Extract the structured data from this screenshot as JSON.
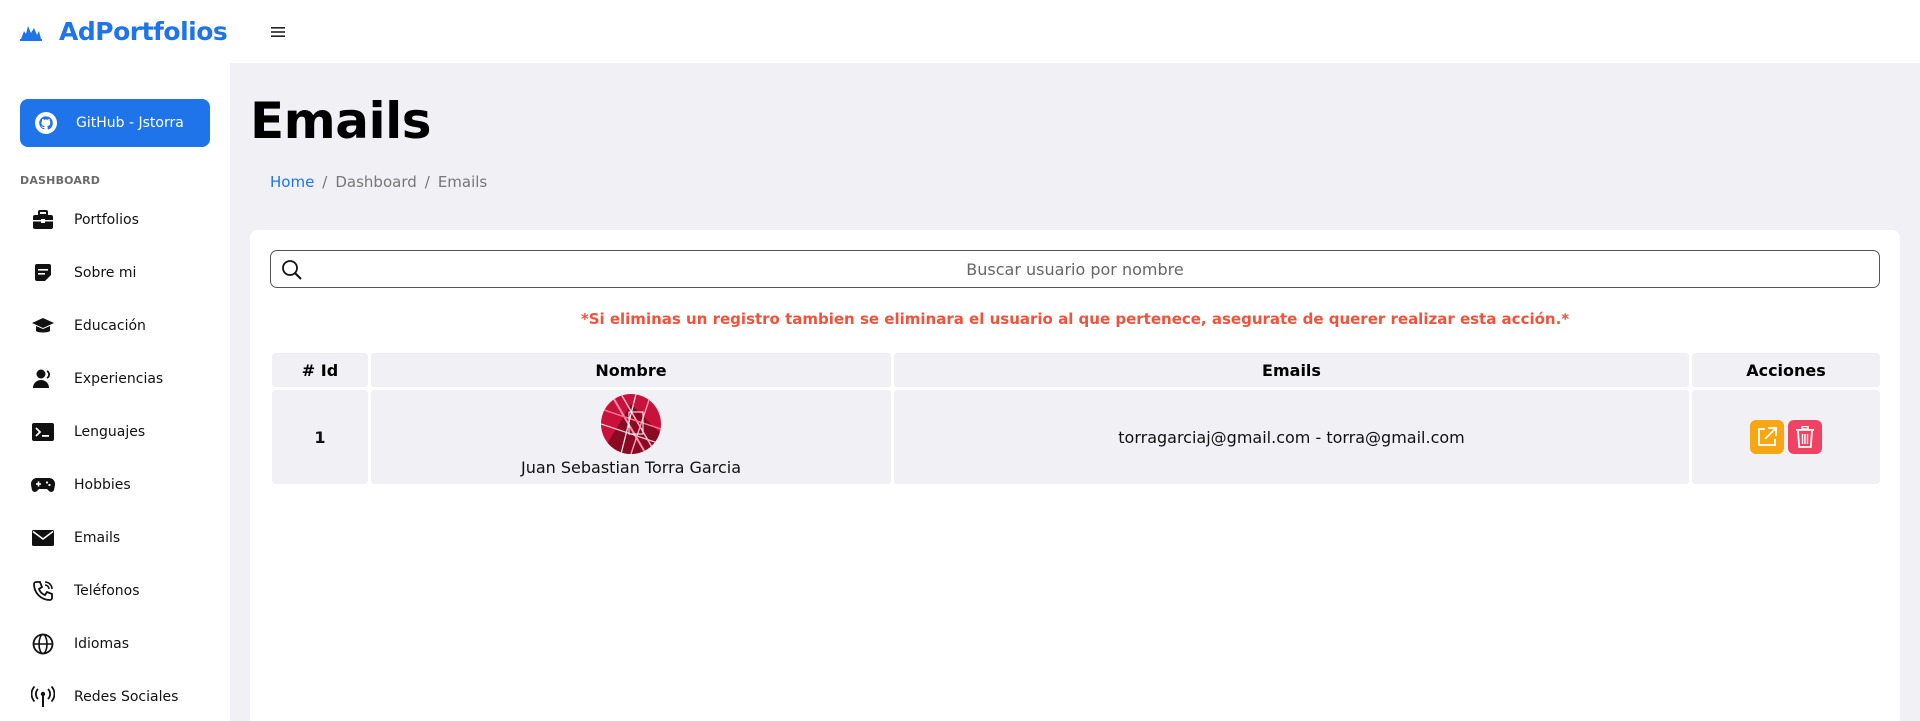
{
  "app": {
    "brand": "AdPortfolios"
  },
  "sidebar": {
    "github_label": "GitHub - Jstorra",
    "section_label": "DASHBOARD",
    "items": [
      {
        "label": "Portfolios",
        "icon": "briefcase-icon"
      },
      {
        "label": "Sobre mi",
        "icon": "note-icon"
      },
      {
        "label": "Educación",
        "icon": "graduation-cap-icon"
      },
      {
        "label": "Experiencias",
        "icon": "user-icon"
      },
      {
        "label": "Lenguajes",
        "icon": "terminal-icon"
      },
      {
        "label": "Hobbies",
        "icon": "gamepad-icon"
      },
      {
        "label": "Emails",
        "icon": "envelope-icon"
      },
      {
        "label": "Teléfonos",
        "icon": "phone-icon"
      },
      {
        "label": "Idiomas",
        "icon": "globe-icon"
      },
      {
        "label": "Redes Sociales",
        "icon": "broadcast-icon"
      }
    ]
  },
  "page": {
    "title": "Emails",
    "breadcrumb": {
      "home": "Home",
      "dashboard": "Dashboard",
      "current": "Emails",
      "separator": "/"
    }
  },
  "search": {
    "placeholder": "Buscar usuario por nombre",
    "value": ""
  },
  "warning": "*Si eliminas un registro tambien se eliminara el usuario al que pertenece, asegurate de querer realizar esta acción.*",
  "table": {
    "headers": {
      "id": "# Id",
      "name": "Nombre",
      "emails": "Emails",
      "actions": "Acciones"
    },
    "rows": [
      {
        "id": "1",
        "name": "Juan Sebastian Torra Garcia",
        "emails": "torragarciaj@gmail.com - torra@gmail.com"
      }
    ]
  },
  "colors": {
    "accent": "#1e74e8",
    "warning": "#f0533c",
    "edit": "#f7a614",
    "delete": "#f04262",
    "background": "#f0f0f5"
  }
}
